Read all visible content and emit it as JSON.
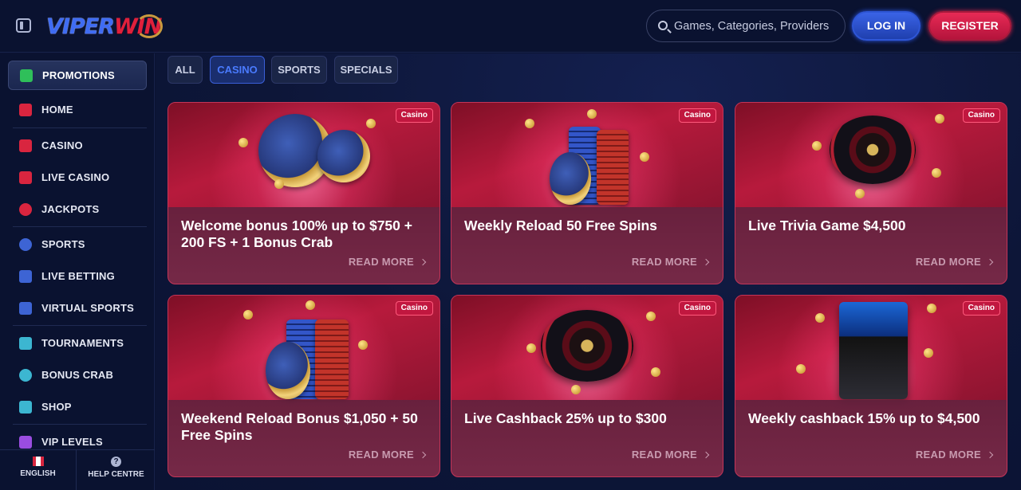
{
  "header": {
    "logo_viper": "VIPER",
    "logo_win": "WIN",
    "search_placeholder": "Games, Categories, Providers",
    "login_label": "LOG IN",
    "register_label": "REGISTER"
  },
  "sidebar": {
    "promotions": "PROMOTIONS",
    "items": [
      {
        "label": "HOME"
      },
      {
        "label": "CASINO"
      },
      {
        "label": "LIVE CASINO"
      },
      {
        "label": "JACKPOTS"
      },
      {
        "label": "SPORTS"
      },
      {
        "label": "LIVE BETTING"
      },
      {
        "label": "VIRTUAL SPORTS"
      },
      {
        "label": "TOURNAMENTS"
      },
      {
        "label": "BONUS CRAB"
      },
      {
        "label": "SHOP"
      },
      {
        "label": "VIP LEVELS"
      }
    ],
    "footer": {
      "language": "ENGLISH",
      "help": "HELP CENTRE"
    }
  },
  "filters": {
    "tabs": [
      "ALL",
      "CASINO",
      "SPORTS",
      "SPECIALS"
    ],
    "active": "CASINO"
  },
  "promotions": [
    {
      "badge": "Casino",
      "title": "Welcome bonus 100% up to $750 + 200 FS + 1 Bonus Crab",
      "cta": "READ MORE",
      "art": "casino-chips-icon"
    },
    {
      "badge": "Casino",
      "title": "Weekly Reload 50 Free Spins",
      "cta": "READ MORE",
      "art": "chip-stack-icon"
    },
    {
      "badge": "Casino",
      "title": "Live Trivia Game $4,500",
      "cta": "READ MORE",
      "art": "roulette-wheel-icon"
    },
    {
      "badge": "Casino",
      "title": "Weekend Reload Bonus $1,050 + 50 Free Spins",
      "cta": "READ MORE",
      "art": "chip-stack-icon"
    },
    {
      "badge": "Casino",
      "title": "Live Cashback 25% up to $300",
      "cta": "READ MORE",
      "art": "roulette-wheel-icon"
    },
    {
      "badge": "Casino",
      "title": "Weekly cashback 15% up to $4,500",
      "cta": "READ MORE",
      "art": "slot-machine-icon"
    }
  ],
  "colors": {
    "background": "#0b1333",
    "login": "#2f5af0",
    "register": "#e0244c",
    "card": "#c22448",
    "active_tab": "#4a7bff"
  }
}
